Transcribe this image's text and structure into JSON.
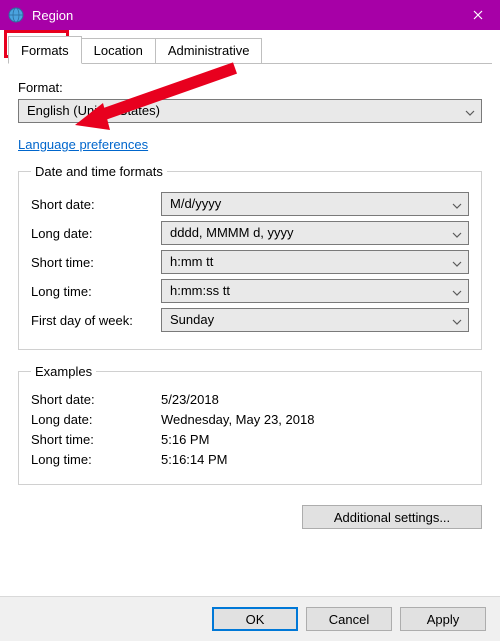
{
  "titlebar": {
    "title": "Region"
  },
  "tabs": {
    "formats": "Formats",
    "location": "Location",
    "admin": "Administrative"
  },
  "format": {
    "label": "Format:",
    "value": "English (United States)"
  },
  "link_langprefs": "Language preferences",
  "dtf": {
    "legend": "Date and time formats",
    "short_date_label": "Short date:",
    "short_date_value": "M/d/yyyy",
    "long_date_label": "Long date:",
    "long_date_value": "dddd, MMMM d, yyyy",
    "short_time_label": "Short time:",
    "short_time_value": "h:mm tt",
    "long_time_label": "Long time:",
    "long_time_value": "h:mm:ss tt",
    "fdow_label": "First day of week:",
    "fdow_value": "Sunday"
  },
  "examples": {
    "legend": "Examples",
    "short_date_label": "Short date:",
    "short_date_value": "5/23/2018",
    "long_date_label": "Long date:",
    "long_date_value": "Wednesday, May 23, 2018",
    "short_time_label": "Short time:",
    "short_time_value": "5:16 PM",
    "long_time_label": "Long time:",
    "long_time_value": "5:16:14 PM"
  },
  "buttons": {
    "additional": "Additional settings...",
    "ok": "OK",
    "cancel": "Cancel",
    "apply": "Apply"
  },
  "colors": {
    "title_bg": "#a700a7",
    "highlight": "#e8001e",
    "link": "#0066cc",
    "ok_border": "#0078d7"
  }
}
